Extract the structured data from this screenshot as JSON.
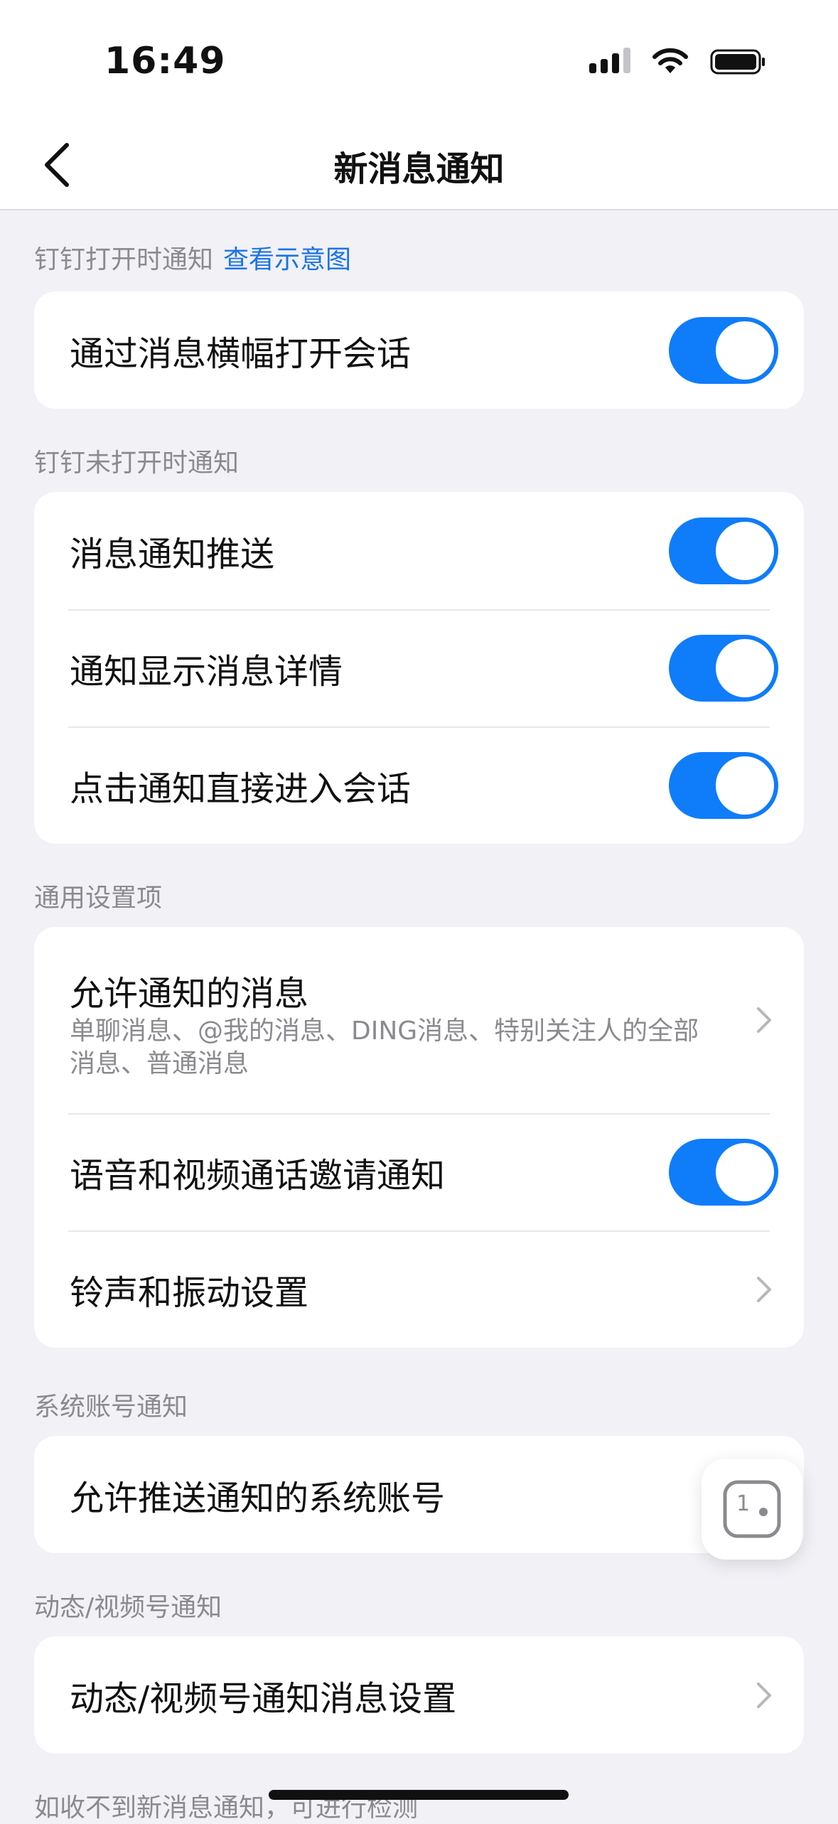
{
  "status_bar": {
    "time": "16:49"
  },
  "nav": {
    "title": "新消息通知"
  },
  "sections": {
    "s1": {
      "label": "钉钉打开时通知",
      "link": "查看示意图"
    },
    "s2": {
      "label": "钉钉未打开时通知"
    },
    "s3": {
      "label": "通用设置项"
    },
    "s4": {
      "label": "系统账号通知"
    },
    "s5": {
      "label": "动态/视频号通知"
    }
  },
  "rows": {
    "banner_open": {
      "label": "通过消息横幅打开会话",
      "on": true
    },
    "push": {
      "label": "消息通知推送",
      "on": true
    },
    "show_detail": {
      "label": "通知显示消息详情",
      "on": true
    },
    "tap_enter": {
      "label": "点击通知直接进入会话",
      "on": true
    },
    "allowed_msgs": {
      "label": "允许通知的消息",
      "sub": "单聊消息、@我的消息、DING消息、特别关注人的全部消息、普通消息"
    },
    "call_invite": {
      "label": "语音和视频通话邀请通知",
      "on": true
    },
    "ringtone": {
      "label": "铃声和振动设置"
    },
    "system_accounts": {
      "label": "允许推送通知的系统账号"
    },
    "moments": {
      "label": "动态/视频号通知消息设置"
    }
  },
  "footer": {
    "hint": "如收不到新消息通知，可进行检测"
  },
  "floater": {
    "badge": "1"
  },
  "colors": {
    "accent": "#0f7cfa",
    "link": "#1a73e8",
    "background": "#f1f1f6"
  }
}
